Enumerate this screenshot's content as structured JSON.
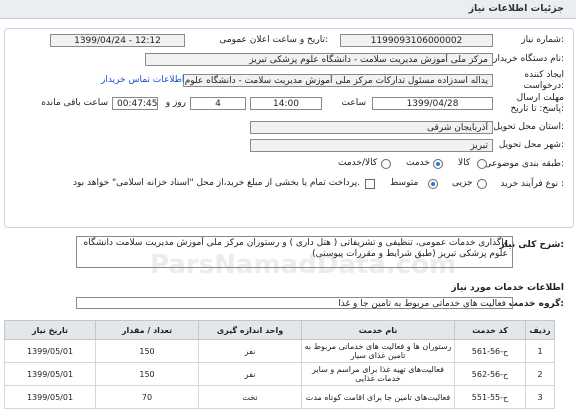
{
  "header": {
    "title": "جزئیات اطلاعات نیاز"
  },
  "form": {
    "need_number_label": "شماره نیاز:",
    "need_number": "1199093106000002",
    "announce_label": "تاریخ و ساعت اعلان عمومی:",
    "announce_value": "1399/04/24 - 12:12",
    "buyer_label": "نام دستگاه خریدار:",
    "buyer_value": "مرکز ملی آموزش مدیریت سلامت - دانشگاه علوم پزشکی تبریز",
    "creator_label": "ایجاد کننده درخواست:",
    "creator_value": "یداله اسدزاده مسئول تدارکات مرکز ملی آموزش مدیریت سلامت - دانشگاه علوم",
    "contact_link": "اطلاعات تماس خریدار",
    "deadline_label": "مهلت ارسال پاسخ: تا تاریخ:",
    "deadline_date": "1399/04/28",
    "hour_label": "ساعت",
    "deadline_time": "14:00",
    "day_word": "روز و",
    "days": "4",
    "remaining_time": "00:47:45",
    "remaining_label": "ساعت باقی مانده",
    "province_label": "استان محل تحویل:",
    "province_value": "آذربایجان شرقی",
    "city_label": "شهر محل تحویل:",
    "city_value": "تبریز",
    "category_label": "طبقه بندی موضوعی:",
    "category_options": [
      "کالا",
      "خدمت",
      "کالا/خدمت"
    ],
    "process_label": "نوع فرآیند خرید :",
    "process_options": [
      "جزیی",
      "متوسط"
    ],
    "payment_note": "پرداخت تمام یا بخشی از مبلغ خرید،از محل \"اسناد خزانه اسلامی\" خواهد بود."
  },
  "summary": {
    "label": "شرح کلی نیاز:",
    "text": "واگذاری خدمات عمومی، تنظیفی و تشریفاتی ( هتل داری ) و رستوران مرکز ملی آموزش مدیریت سلامت دانشگاه علوم پزشکی تبریز (طبق شرایط و مقررات پیوستی)"
  },
  "services": {
    "section_title": "اطلاعات خدمات مورد نیاز",
    "group_label": "گروه خدمت:",
    "group_value": "فعالیت های خدماتی مربوط به تامین جا و غذا",
    "watermark": "ParsNamadData.com",
    "columns": [
      "ردیف",
      "کد خدمت",
      "نام خدمت",
      "واحد اندازه گیری",
      "تعداد / مقدار",
      "تاریخ نیاز"
    ],
    "rows": [
      {
        "row": "1",
        "code": "ح-56-561",
        "name": "رستوران ها و فعالیت های خدماتی مربوط به تامین غذای سیار",
        "unit": "نفر",
        "qty": "150",
        "date": "1399/05/01"
      },
      {
        "row": "2",
        "code": "ح-56-562",
        "name": "فعالیت‌های تهیه غذا برای مراسم و سایر خدمات غذایی",
        "unit": "نفر",
        "qty": "150",
        "date": "1399/05/01"
      },
      {
        "row": "3",
        "code": "ح-55-551",
        "name": "فعالیت‌های تامین جا برای اقامت کوتاه مدت",
        "unit": "تخت",
        "qty": "70",
        "date": "1399/05/01"
      }
    ]
  }
}
